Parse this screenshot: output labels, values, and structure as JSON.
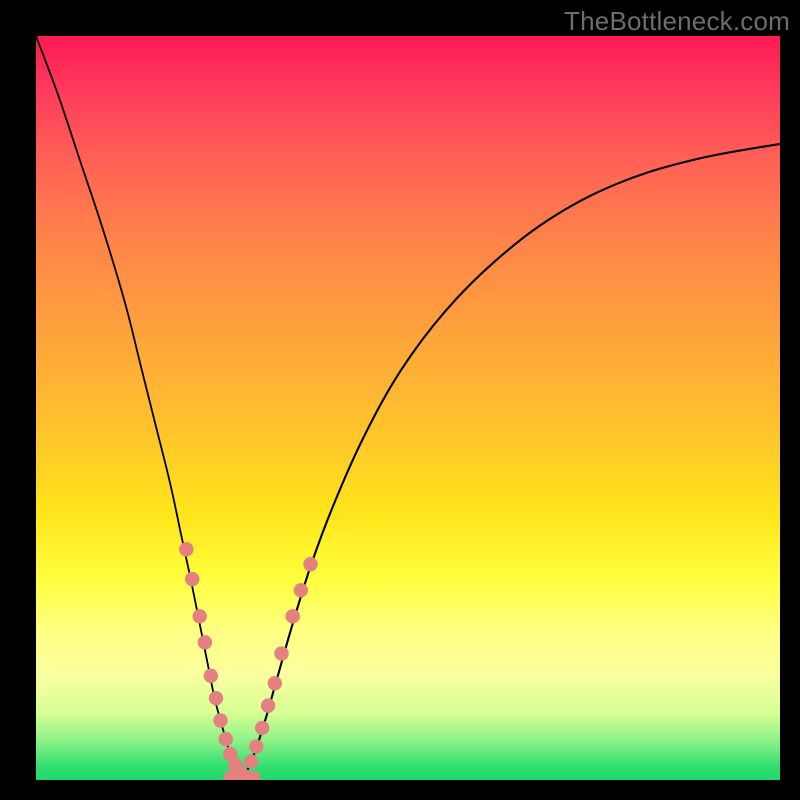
{
  "watermark": "TheBottleneck.com",
  "colors": {
    "frame_bg": "#000000",
    "marker": "#e58080",
    "curve": "#000000",
    "gradient": [
      "#ff1a53",
      "#ff355b",
      "#ff5f56",
      "#ff8549",
      "#ffa33c",
      "#ffc12d",
      "#ffe41a",
      "#ffff3e",
      "#ffff84",
      "#f9ff9e",
      "#d7ff94",
      "#86f186",
      "#35e072",
      "#1ed968"
    ]
  },
  "chart_data": {
    "type": "line",
    "title": "",
    "xlabel": "",
    "ylabel": "",
    "xlim": [
      0,
      100
    ],
    "ylim": [
      0,
      100
    ],
    "annotations": [
      {
        "text": "TheBottleneck.com",
        "pos": "top-right"
      }
    ],
    "series": [
      {
        "name": "left-branch",
        "x": [
          0,
          3,
          6,
          9,
          12,
          14,
          16,
          18,
          19.5,
          21,
          22.2,
          23.2,
          24,
          24.8,
          25.5,
          26.1,
          26.7,
          27.2,
          27.7
        ],
        "y": [
          100,
          92,
          83,
          74,
          64,
          56,
          48,
          40,
          33,
          26,
          20,
          15,
          11,
          8,
          5.5,
          3.5,
          2.1,
          1.1,
          0.4
        ]
      },
      {
        "name": "right-branch",
        "x": [
          27.7,
          28.5,
          29.5,
          30.8,
          32.5,
          34.5,
          37,
          40,
          44,
          49,
          55,
          62,
          70,
          79,
          89,
          100
        ],
        "y": [
          0.4,
          1.5,
          4,
          8,
          14,
          21,
          29,
          37,
          46,
          55,
          63,
          70,
          76,
          80.5,
          83.5,
          85.5
        ]
      },
      {
        "name": "markers-left-branch",
        "type": "scatter",
        "x": [
          20.2,
          21.0,
          22.0,
          22.7,
          23.5,
          24.2,
          24.8,
          25.5,
          26.1,
          26.8,
          27.4,
          28.1
        ],
        "y": [
          31.0,
          27.0,
          22.0,
          18.5,
          14.0,
          11.0,
          8.0,
          5.5,
          3.5,
          2.0,
          1.0,
          0.5
        ]
      },
      {
        "name": "markers-right-branch",
        "type": "scatter",
        "x": [
          28.9,
          29.6,
          30.4,
          31.2,
          32.1,
          33.0,
          34.5,
          35.6,
          36.9
        ],
        "y": [
          2.5,
          4.5,
          7.0,
          10.0,
          13.0,
          17.0,
          22.0,
          25.5,
          29.0
        ]
      },
      {
        "name": "markers-valley-floor",
        "type": "scatter",
        "x": [
          26.1,
          26.9,
          27.7,
          28.5,
          29.3
        ],
        "y": [
          0.4,
          0.2,
          0.15,
          0.2,
          0.35
        ]
      }
    ]
  }
}
